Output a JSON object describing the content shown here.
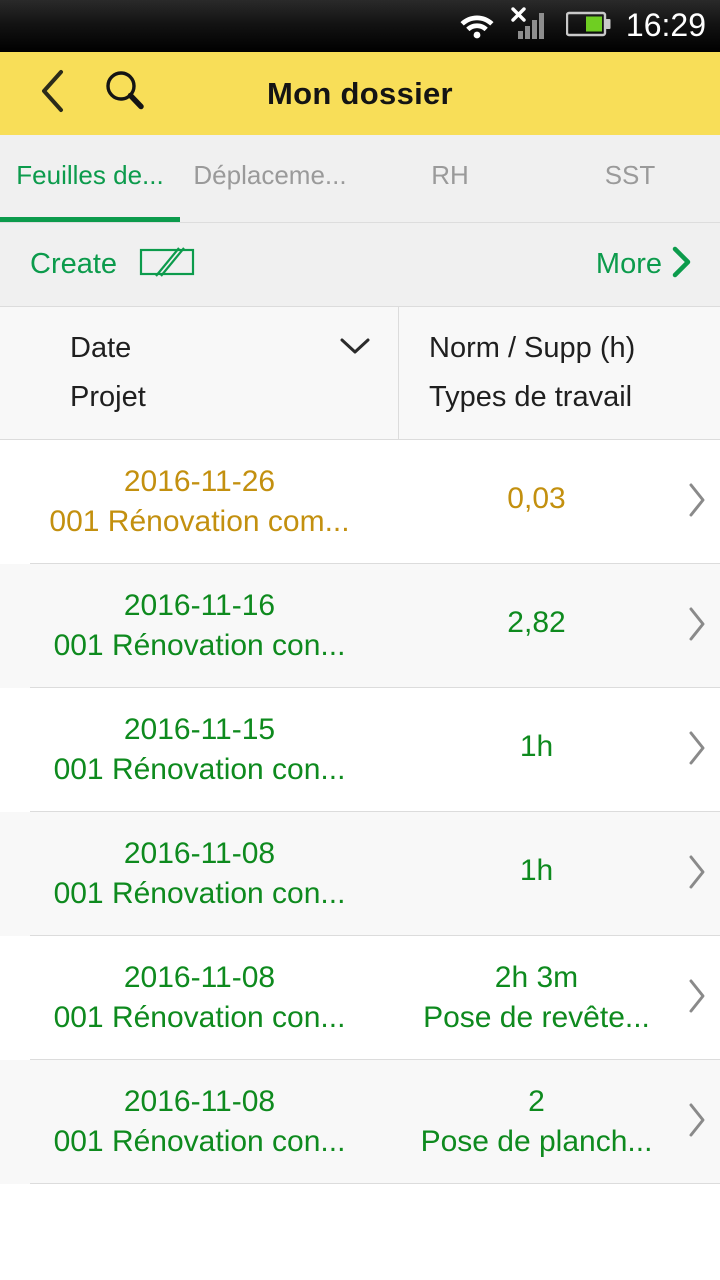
{
  "status_bar": {
    "icons": [
      "wifi-icon",
      "signal-no-sim-icon",
      "battery-icon"
    ],
    "time": "16:29",
    "battery_color": "#6FCE22"
  },
  "app_bar": {
    "back_icon": "chevron-left-icon",
    "search_icon": "search-icon",
    "title": "Mon dossier",
    "background": "#F8DE58"
  },
  "tabs": {
    "accent": "#0C9B4C",
    "inactive_color": "#9A9A9A",
    "items": [
      {
        "label": "Feuilles de...",
        "active": true
      },
      {
        "label": "Déplaceme...",
        "active": false
      },
      {
        "label": "RH",
        "active": false
      },
      {
        "label": "SST",
        "active": false
      }
    ]
  },
  "action_bar": {
    "create_label": "Create",
    "create_icon": "edit-note-icon",
    "more_label": "More",
    "more_icon": "chevron-right-icon"
  },
  "column_header": {
    "left_primary": "Date",
    "left_sort_icon": "chevron-down-icon",
    "left_secondary": "Projet",
    "right_primary": "Norm / Supp (h)",
    "right_secondary": "Types de travail"
  },
  "rows": [
    {
      "date": "2016-11-26",
      "project": "001 Rénovation com...",
      "hours": "0,03",
      "work_type": "",
      "color": "amber",
      "chevron_icon": "chevron-right-icon"
    },
    {
      "date": "2016-11-16",
      "project": "001 Rénovation con...",
      "hours": "2,82",
      "work_type": "",
      "color": "green",
      "chevron_icon": "chevron-right-icon"
    },
    {
      "date": "2016-11-15",
      "project": "001 Rénovation con...",
      "hours": "1h",
      "work_type": "",
      "color": "green",
      "chevron_icon": "chevron-right-icon"
    },
    {
      "date": "2016-11-08",
      "project": "001 Rénovation con...",
      "hours": "1h",
      "work_type": "",
      "color": "green",
      "chevron_icon": "chevron-right-icon"
    },
    {
      "date": "2016-11-08",
      "project": "001 Rénovation con...",
      "hours": "2h 3m",
      "work_type": "Pose de revête...",
      "color": "green",
      "chevron_icon": "chevron-right-icon"
    },
    {
      "date": "2016-11-08",
      "project": "001 Rénovation con...",
      "hours": "2",
      "work_type": "Pose de planch...",
      "color": "green",
      "chevron_icon": "chevron-right-icon"
    }
  ],
  "colors": {
    "green": "#0E8A1E",
    "amber": "#C3900F",
    "accent_green": "#0C9B4C",
    "header_yellow": "#F8DE58"
  }
}
